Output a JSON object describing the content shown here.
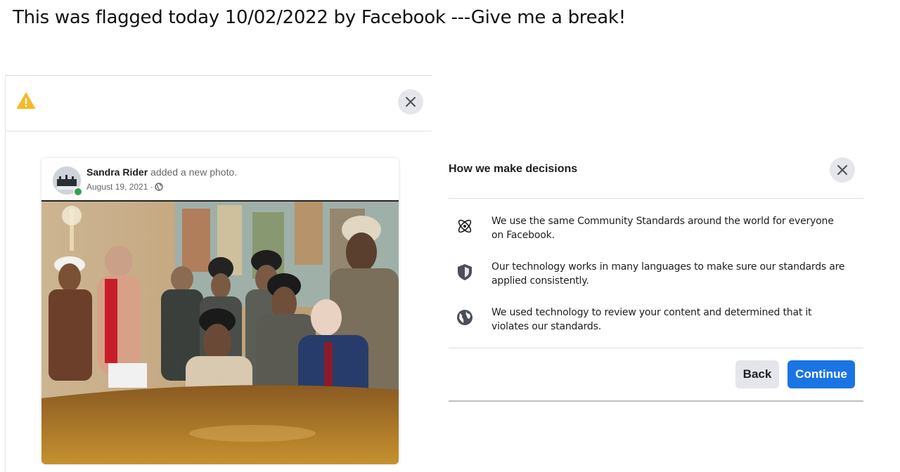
{
  "caption": "This was flagged today 10/02/2022 by Facebook ---Give me a break!",
  "left_dialog": {
    "icons": {
      "warning": "warning-triangle-icon",
      "close": "close-icon"
    },
    "post": {
      "author": "Sandra Rider",
      "action": "added a new photo.",
      "date": "August 19, 2021 ·",
      "privacy_icon": "globe-icon"
    }
  },
  "right_dialog": {
    "title": "How we make decisions",
    "items": [
      {
        "icon": "atom-icon",
        "text": "We use the same Community Standards around the world for everyone on Facebook."
      },
      {
        "icon": "shield-icon",
        "text": "Our technology works in many languages to make sure our standards are applied consistently."
      },
      {
        "icon": "globe-icon",
        "text": "We used technology to review your content and determined that it violates our standards."
      }
    ],
    "back_label": "Back",
    "continue_label": "Continue"
  },
  "colors": {
    "primary_button": "#1b74e4",
    "secondary_button": "#e4e6eb",
    "warning": "#f7b928",
    "online": "#31a24c"
  }
}
